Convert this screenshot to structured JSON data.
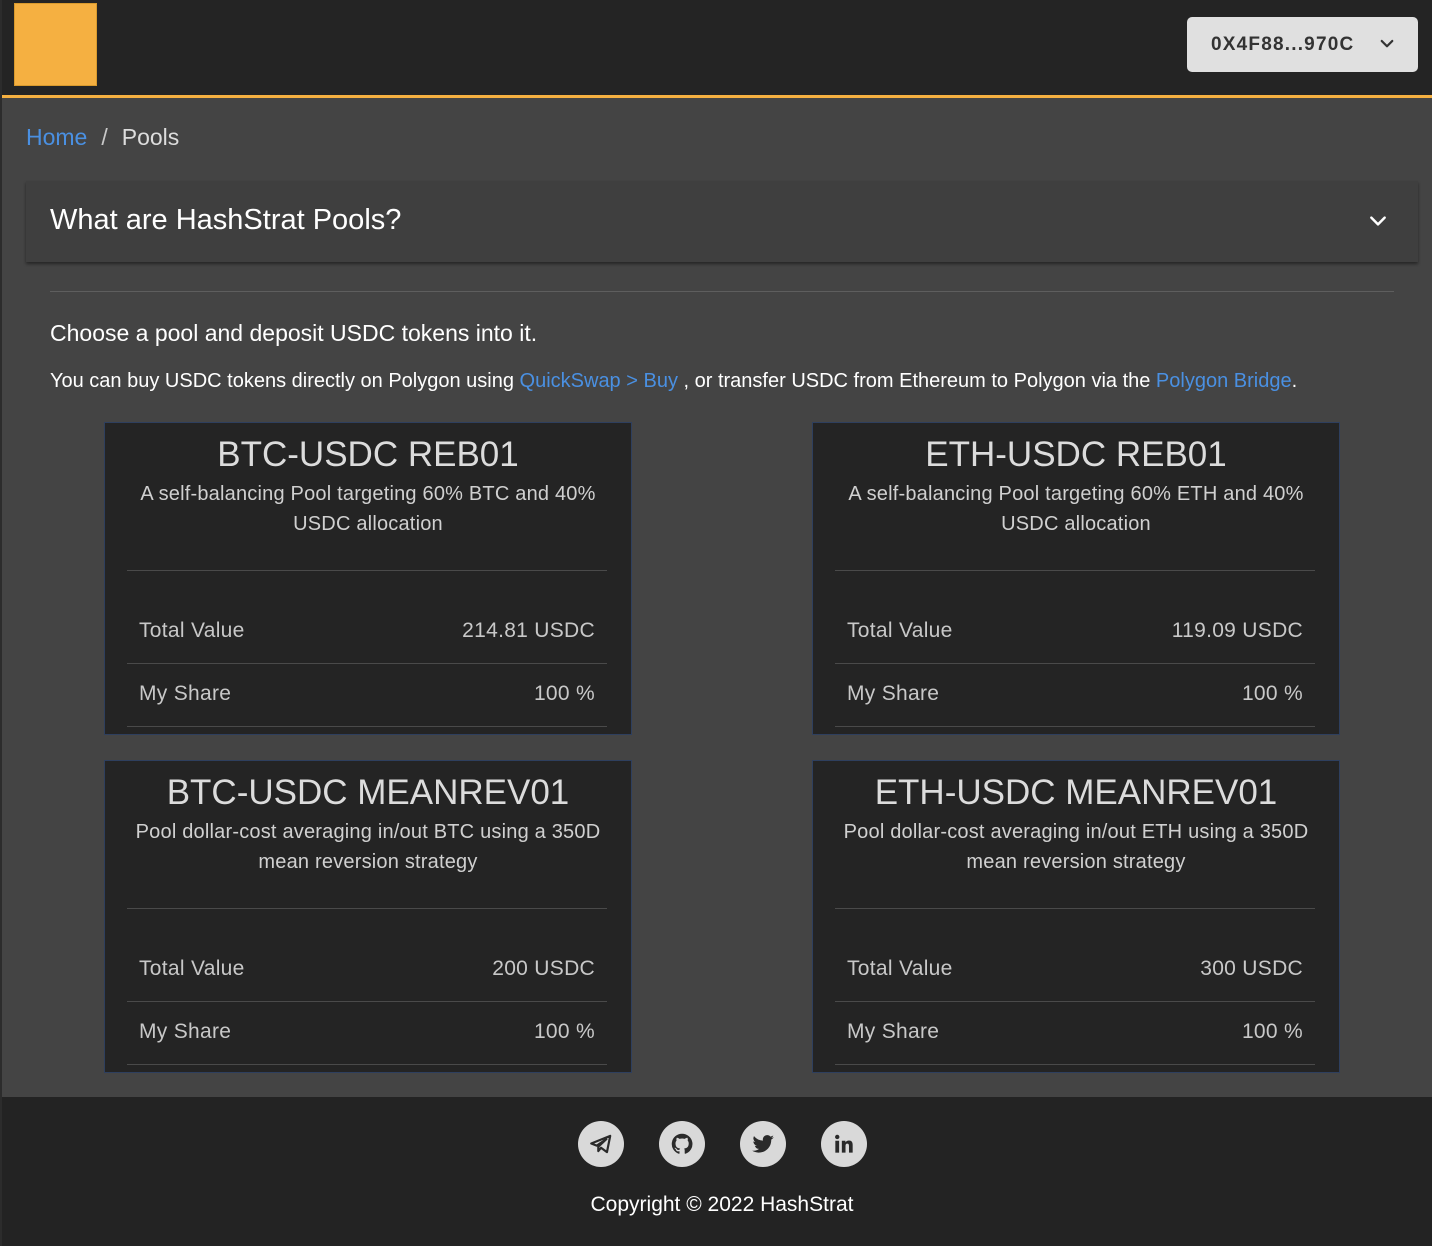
{
  "header": {
    "logo": "logo",
    "account_label": "0X4F88...970C",
    "accent_color": "#f5b041"
  },
  "breadcrumb": {
    "home": "Home",
    "separator": "/",
    "current": "Pools"
  },
  "accordion": {
    "title": "What are HashStrat Pools?"
  },
  "intro": "Choose a pool and deposit USDC tokens into it.",
  "note": {
    "prefix": "You can buy USDC tokens directly on Polygon using ",
    "link1": "QuickSwap > Buy",
    "middle": " , or transfer USDC from Ethereum to Polygon via the ",
    "link2": "Polygon Bridge",
    "suffix": "."
  },
  "pools": [
    {
      "title": "BTC-USDC REB01",
      "description": "A self-balancing Pool targeting 60% BTC and 40% USDC allocation",
      "total_value_label": "Total Value",
      "total_value": "214.81 USDC",
      "my_share_label": "My Share",
      "my_share": "100 %"
    },
    {
      "title": "ETH-USDC REB01",
      "description": "A self-balancing Pool targeting 60% ETH and 40% USDC allocation",
      "total_value_label": "Total Value",
      "total_value": "119.09 USDC",
      "my_share_label": "My Share",
      "my_share": "100 %"
    },
    {
      "title": "BTC-USDC MEANREV01",
      "description": "Pool dollar-cost averaging in/out BTC using a 350D mean reversion strategy",
      "total_value_label": "Total Value",
      "total_value": "200 USDC",
      "my_share_label": "My Share",
      "my_share": "100 %"
    },
    {
      "title": "ETH-USDC MEANREV01",
      "description": "Pool dollar-cost averaging in/out ETH using a 350D mean reversion strategy",
      "total_value_label": "Total Value",
      "total_value": "300 USDC",
      "my_share_label": "My Share",
      "my_share": "100 %"
    }
  ],
  "footer": {
    "social_icons": [
      "telegram-icon",
      "github-icon",
      "twitter-icon",
      "linkedin-icon"
    ],
    "copyright": "Copyright © 2022 HashStrat"
  }
}
